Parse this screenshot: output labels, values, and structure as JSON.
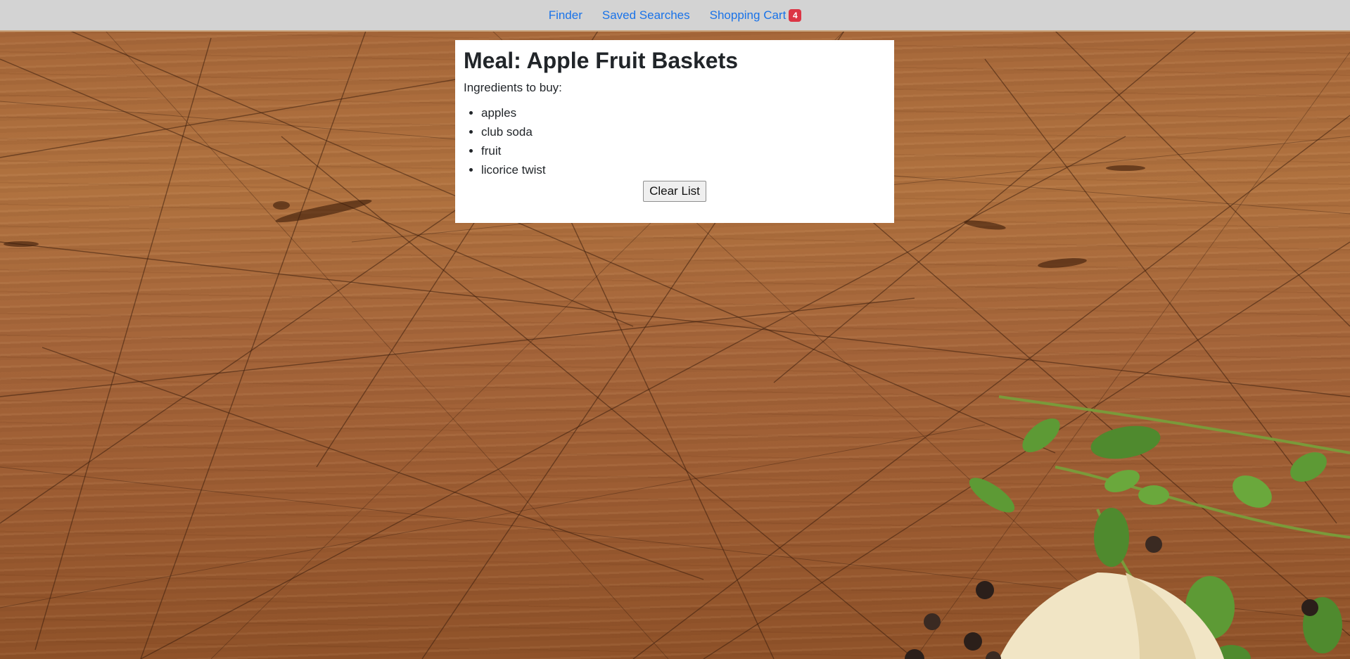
{
  "nav": {
    "items": [
      {
        "label": "Finder"
      },
      {
        "label": "Saved Searches"
      },
      {
        "label": "Shopping Cart"
      }
    ],
    "cart_count": "4"
  },
  "card": {
    "title": "Meal: Apple Fruit Baskets",
    "subtitle": "Ingredients to buy:",
    "ingredients": [
      "apples",
      "club soda",
      "fruit",
      "licorice twist"
    ],
    "clear_button_label": "Clear List"
  },
  "colors": {
    "nav_bg": "#d3d3d3",
    "link": "#1a73e8",
    "badge": "#dc3545",
    "wood": "#a7683a"
  }
}
